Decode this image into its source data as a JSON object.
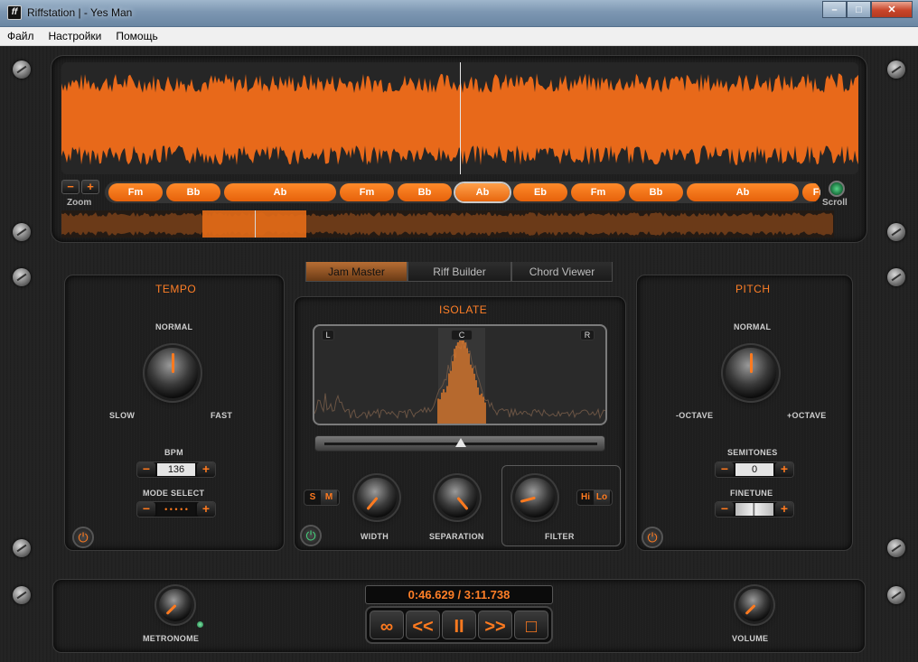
{
  "window": {
    "title": "Riffstation |  - Yes Man",
    "app_icon": "ff",
    "minimize": "–",
    "maximize": "□",
    "close": "✕"
  },
  "menu": [
    "Файл",
    "Настройки",
    "Помощь"
  ],
  "timeline": {
    "zoom_label": "Zoom",
    "zoom_minus": "−",
    "zoom_plus": "+",
    "scroll_label": "Scroll",
    "chords": [
      {
        "name": "Fm"
      },
      {
        "name": "Bb"
      },
      {
        "name": "Ab"
      },
      {
        "name": "Fm"
      },
      {
        "name": "Bb"
      },
      {
        "name": "Ab",
        "selected": true
      },
      {
        "name": "Eb"
      },
      {
        "name": "Fm"
      },
      {
        "name": "Bb"
      },
      {
        "name": "Ab"
      },
      {
        "name": "Fm"
      }
    ]
  },
  "tabs": [
    "Jam Master",
    "Riff Builder",
    "Chord Viewer"
  ],
  "tempo": {
    "title": "TEMPO",
    "normal": "NORMAL",
    "slow": "SLOW",
    "fast": "FAST",
    "bpm_label": "BPM",
    "bpm_value": "136",
    "mode_label": "MODE SELECT",
    "mode_value": "• • • • •",
    "minus": "−",
    "plus": "+"
  },
  "isolate": {
    "title": "ISOLATE",
    "left": "L",
    "center": "C",
    "right": "R",
    "s": "S",
    "m": "M",
    "hi": "Hi",
    "lo": "Lo",
    "width": "WIDTH",
    "separation": "SEPARATION",
    "filter": "FILTER"
  },
  "pitch": {
    "title": "PITCH",
    "normal": "NORMAL",
    "minus_octave": "-OCTAVE",
    "plus_octave": "+OCTAVE",
    "semitones_label": "SEMITONES",
    "semitones_value": "0",
    "finetune_label": "FINETUNE",
    "minus": "−",
    "plus": "+"
  },
  "transport": {
    "time": "0:46.629 / 3:11.738",
    "loop": "∞",
    "rewind": "<<",
    "pause": "II",
    "forward": ">>",
    "stop": "□",
    "metronome": "METRONOME",
    "volume": "VOLUME"
  },
  "colors": {
    "accent": "#ff7a1f",
    "waveform": "#e8691a",
    "power_on": "#45d17c"
  }
}
